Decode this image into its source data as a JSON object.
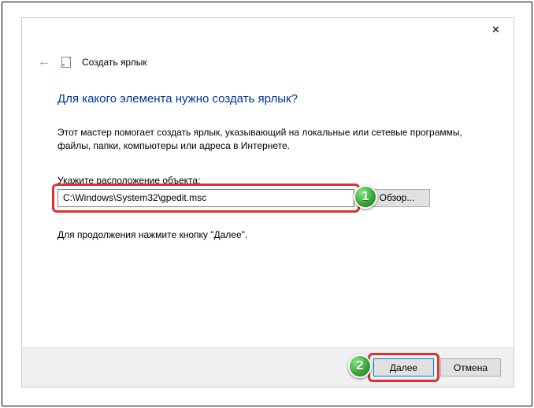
{
  "wizard": {
    "title": "Создать ярлык",
    "heading": "Для какого элемента нужно создать ярлык?",
    "description": "Этот мастер помогает создать ярлык, указывающий на локальные или сетевые программы, файлы, папки, компьютеры или адреса в Интернете.",
    "location_label": "Укажите расположение объекта:",
    "path_value": "C:\\Windows\\System32\\gpedit.msc",
    "browse_label": "Обзор...",
    "continue_hint": "Для продолжения нажмите кнопку \"Далее\".",
    "next_label": "Далее",
    "cancel_label": "Отмена"
  },
  "annotations": {
    "a1": "1",
    "a2": "2"
  }
}
